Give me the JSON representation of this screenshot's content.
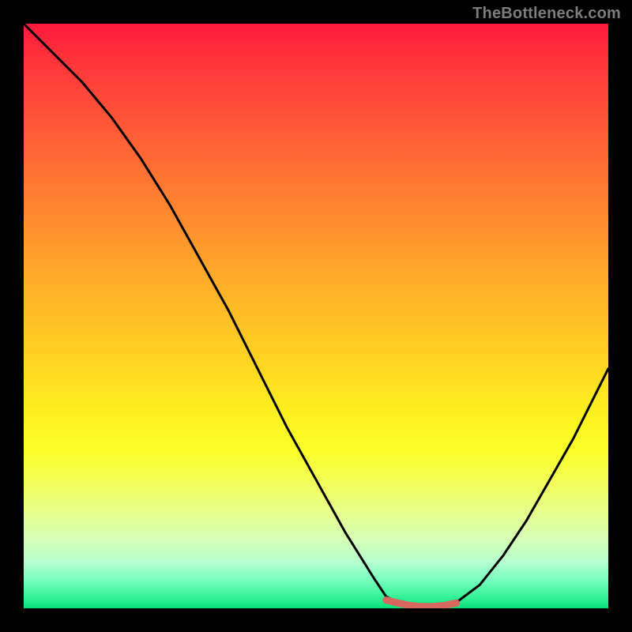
{
  "watermark": {
    "text": "TheBottleneck.com",
    "color": "#7d7d7d"
  },
  "chart_data": {
    "type": "line",
    "title": "",
    "xlabel": "",
    "ylabel": "",
    "xlim": [
      0,
      100
    ],
    "ylim": [
      0,
      100
    ],
    "series": [
      {
        "name": "black-curve",
        "color": "#000000",
        "x": [
          0,
          5,
          10,
          15,
          20,
          25,
          30,
          35,
          40,
          45,
          50,
          55,
          60,
          62,
          64,
          68,
          72,
          74,
          78,
          82,
          86,
          90,
          94,
          98,
          100
        ],
        "values": [
          100,
          95,
          90,
          84,
          77,
          69,
          60,
          51,
          41,
          31,
          22,
          13,
          5,
          2,
          1,
          0,
          0,
          1,
          4,
          9,
          15,
          22,
          29,
          37,
          41
        ]
      },
      {
        "name": "red-flat-segment",
        "color": "#d8675f",
        "x": [
          62,
          64,
          66,
          68,
          70,
          72,
          74
        ],
        "values": [
          1.4,
          0.9,
          0.5,
          0.3,
          0.3,
          0.5,
          0.9
        ]
      }
    ],
    "background_gradient_stops": [
      {
        "pos": 0,
        "color": "#ff1a3c"
      },
      {
        "pos": 8,
        "color": "#ff3a3a"
      },
      {
        "pos": 18,
        "color": "#ff5a37"
      },
      {
        "pos": 28,
        "color": "#ff7a32"
      },
      {
        "pos": 38,
        "color": "#ff9a2c"
      },
      {
        "pos": 48,
        "color": "#ffb927"
      },
      {
        "pos": 58,
        "color": "#ffd522"
      },
      {
        "pos": 66,
        "color": "#feef1e"
      },
      {
        "pos": 73,
        "color": "#fbff28"
      },
      {
        "pos": 78,
        "color": "#f4ff55"
      },
      {
        "pos": 83,
        "color": "#e8ff88"
      },
      {
        "pos": 88,
        "color": "#d6ffb4"
      },
      {
        "pos": 92,
        "color": "#b6ffce"
      },
      {
        "pos": 95,
        "color": "#7cffc2"
      },
      {
        "pos": 98,
        "color": "#36f396"
      },
      {
        "pos": 100,
        "color": "#06e079"
      }
    ]
  }
}
